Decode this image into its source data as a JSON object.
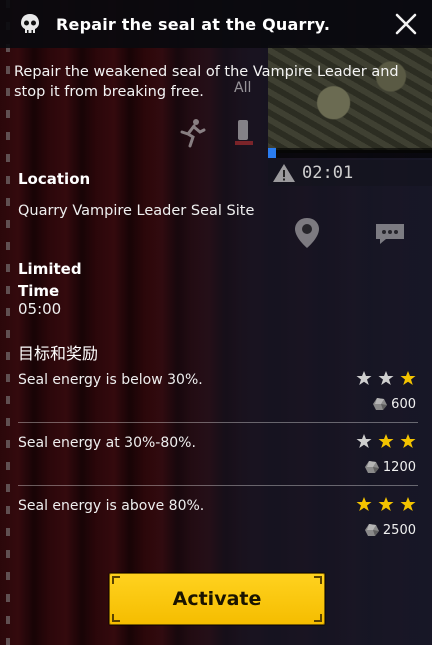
{
  "header": {
    "title": "Repair the seal at the Quarry.",
    "skull_icon": "skull-icon",
    "close_icon": "close-icon"
  },
  "description": "Repair the weakened seal of the Vampire Leader and stop it from breaking free.",
  "hud": {
    "all_label": "All",
    "timer": "02:01",
    "minimap_progress": 0.05
  },
  "location": {
    "label": "Location",
    "value": "Quarry Vampire Leader Seal Site"
  },
  "limited_time": {
    "label": "Limited Time",
    "value": "05:00"
  },
  "rewards": {
    "heading": "目标和奖励",
    "goals": [
      {
        "text": "Seal energy is below 30%.",
        "stars_filled": 1,
        "stars_total": 3,
        "reward": "600"
      },
      {
        "text": "Seal energy at 30%-80%.",
        "stars_filled": 2,
        "stars_total": 3,
        "reward": "1200"
      },
      {
        "text": "Seal energy is above 80%.",
        "stars_filled": 3,
        "stars_total": 3,
        "reward": "2500"
      }
    ]
  },
  "activate_label": "Activate",
  "colors": {
    "star_filled": "#f3c300",
    "star_empty": "#cfcfcf",
    "button": "#f9c80e"
  }
}
